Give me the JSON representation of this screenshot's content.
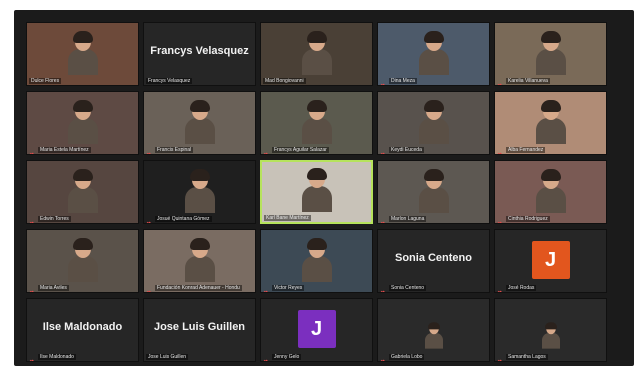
{
  "colors": {
    "avatar_j_purple": "#7b2fbf",
    "avatar_j_orange": "#e2561e",
    "active_border": "#b6e35c"
  },
  "tiles": [
    {
      "name": "Dulce Flores",
      "kind": "video",
      "muted": false
    },
    {
      "name": "Francys Velasquez",
      "kind": "name",
      "center": "Francys Velasquez",
      "muted": false
    },
    {
      "name": "Mad Bongiovanni",
      "kind": "video",
      "muted": false
    },
    {
      "name": "Dina Meza",
      "kind": "video",
      "muted": true
    },
    {
      "name": "Karelia Villanueva",
      "kind": "video",
      "muted": true
    },
    {
      "name": "Maria Estela Martínez",
      "kind": "video",
      "muted": true
    },
    {
      "name": "Francis Espinal",
      "kind": "video",
      "muted": true
    },
    {
      "name": "Francys Aguilar Salazar",
      "kind": "video",
      "muted": true
    },
    {
      "name": "Keydi Euceda",
      "kind": "video",
      "muted": true
    },
    {
      "name": "Alba Fernandez",
      "kind": "video",
      "muted": true
    },
    {
      "name": "Edwin Torres",
      "kind": "video",
      "muted": true
    },
    {
      "name": "Josué Quintana Gómez",
      "kind": "video-dark",
      "muted": true
    },
    {
      "name": "Karl Bane Martínez",
      "kind": "video",
      "muted": false,
      "active": true
    },
    {
      "name": "Marlon Laguna",
      "kind": "video",
      "muted": true
    },
    {
      "name": "Cinthia Rodriguez",
      "kind": "video",
      "muted": true
    },
    {
      "name": "Maria Aviles",
      "kind": "video",
      "muted": true
    },
    {
      "name": "Fundación Konrad Adenauer - Hondu",
      "kind": "video",
      "muted": true
    },
    {
      "name": "Victor Reyes",
      "kind": "video",
      "muted": true
    },
    {
      "name": "Sonia Centeno",
      "kind": "name",
      "center": "Sonia Centeno",
      "muted": true
    },
    {
      "name": "José Rodas",
      "kind": "avatar",
      "letter": "J",
      "color": "#e2561e",
      "muted": true
    },
    {
      "name": "Ilse Maldonado",
      "kind": "name",
      "center": "Ilse Maldonado",
      "muted": true
    },
    {
      "name": "Jose Luis Guillen",
      "kind": "name",
      "center": "Jose Luis Guillen",
      "muted": false
    },
    {
      "name": "Jenny Gelo",
      "kind": "avatar",
      "letter": "J",
      "color": "#7b2fbf",
      "muted": true
    },
    {
      "name": "Gabriela Lobo",
      "kind": "video-small",
      "muted": true
    },
    {
      "name": "Samantha Lagos",
      "kind": "video-small",
      "muted": true
    }
  ]
}
